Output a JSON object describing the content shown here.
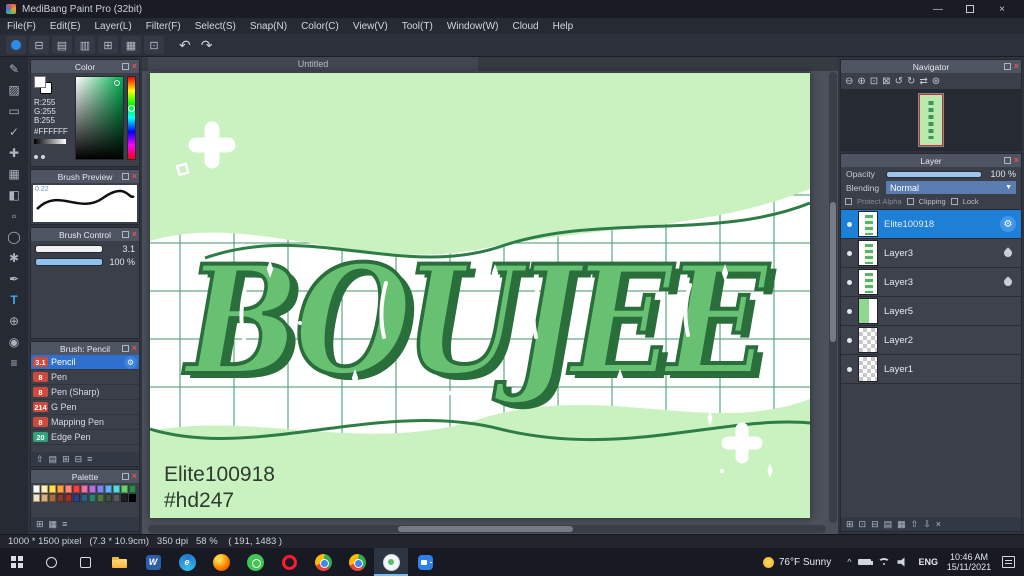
{
  "ui": {
    "close_glyph": "×",
    "caret_glyph": "▼"
  },
  "titlebar": {
    "title": "MediBang Paint Pro (32bit)",
    "minimize_glyph": "—",
    "close_glyph": "×"
  },
  "menubar": {
    "items": [
      {
        "name": "menu-file",
        "label": "File(F)"
      },
      {
        "name": "menu-edit",
        "label": "Edit(E)"
      },
      {
        "name": "menu-layer",
        "label": "Layer(L)"
      },
      {
        "name": "menu-filter",
        "label": "Filter(F)"
      },
      {
        "name": "menu-select",
        "label": "Select(S)"
      },
      {
        "name": "menu-snap",
        "label": "Snap(N)"
      },
      {
        "name": "menu-color",
        "label": "Color(C)"
      },
      {
        "name": "menu-view",
        "label": "View(V)"
      },
      {
        "name": "menu-tool",
        "label": "Tool(T)"
      },
      {
        "name": "menu-window",
        "label": "Window(W)"
      },
      {
        "name": "menu-cloud",
        "label": "Cloud"
      },
      {
        "name": "menu-help",
        "label": "Help"
      }
    ]
  },
  "toolbar": {
    "icons": [
      {
        "name": "save-icon",
        "glyph": "⊟"
      },
      {
        "name": "message-icon",
        "glyph": "▤"
      },
      {
        "name": "new-doc-icon",
        "glyph": "▥"
      },
      {
        "name": "open-doc-icon",
        "glyph": "⊞"
      },
      {
        "name": "grid-view-icon",
        "glyph": "▦"
      },
      {
        "name": "material-panel-icon",
        "glyph": "⊡"
      }
    ],
    "undo_glyph": "↶",
    "redo_glyph": "↷"
  },
  "tools": [
    {
      "name": "tool-brush",
      "glyph": "✎"
    },
    {
      "name": "tool-eraser",
      "glyph": "▨"
    },
    {
      "name": "tool-select-rect",
      "glyph": "▭"
    },
    {
      "name": "tool-snap",
      "glyph": "✓"
    },
    {
      "name": "tool-move",
      "glyph": "✚"
    },
    {
      "name": "tool-bucket",
      "glyph": "▦"
    },
    {
      "name": "tool-gradient",
      "glyph": "◧"
    },
    {
      "name": "tool-select",
      "glyph": "▫"
    },
    {
      "name": "tool-lasso",
      "glyph": "◯"
    },
    {
      "name": "tool-magic-wand",
      "glyph": "✱"
    },
    {
      "name": "tool-select-pen",
      "glyph": "✒"
    },
    {
      "name": "tool-text",
      "glyph": "T",
      "accent": true
    },
    {
      "name": "tool-eyedropper",
      "glyph": "⊕"
    },
    {
      "name": "tool-zoom",
      "glyph": "◉"
    },
    {
      "name": "tool-hand",
      "glyph": "≡"
    }
  ],
  "color_panel": {
    "title": "Color",
    "r": "R:255",
    "g": "G:255",
    "b": "B:255",
    "hex": "#FFFFFF"
  },
  "brush_preview": {
    "title": "Brush Preview",
    "value": "0.22"
  },
  "brush_control": {
    "title": "Brush Control",
    "size_value": "3.1",
    "opacity_value": "100 %"
  },
  "brush_panel": {
    "title": "Brush: Pencil",
    "gear_glyph": "⚙",
    "brushes": [
      {
        "size": "3.1",
        "name": "Pencil",
        "badge": "#d04a3c",
        "selected": true
      },
      {
        "size": "8",
        "name": "Pen",
        "badge": "#d04a3c"
      },
      {
        "size": "8",
        "name": "Pen (Sharp)",
        "badge": "#d04a3c"
      },
      {
        "size": "214",
        "name": "G Pen",
        "badge": "#d04a3c"
      },
      {
        "size": "8",
        "name": "Mapping Pen",
        "badge": "#d04a3c"
      },
      {
        "size": "20",
        "name": "Edge Pen",
        "badge": "#2fa37c"
      }
    ],
    "toolbar": [
      {
        "name": "brush-up-icon",
        "glyph": "⇧"
      },
      {
        "name": "brush-menu-icon",
        "glyph": "▤"
      },
      {
        "name": "add-brush-icon",
        "glyph": "⊞"
      },
      {
        "name": "remove-brush-icon",
        "glyph": "⊟"
      },
      {
        "name": "brush-settings-icon",
        "glyph": "≡"
      }
    ]
  },
  "palette_panel": {
    "title": "Palette",
    "colors": [
      "#ffffff",
      "#fff3b2",
      "#ffe14d",
      "#ffa343",
      "#ff8a80",
      "#f4433c",
      "#f06fae",
      "#b96fd8",
      "#7e86f2",
      "#5fb2f5",
      "#59dcd8",
      "#6fd06f",
      "#2e8b4a",
      "#f2e3c2",
      "#d8b07e",
      "#a3713f",
      "#7e402e",
      "#a33030",
      "#2e4080",
      "#2e6080",
      "#2e8070",
      "#4f7840",
      "#3f503f",
      "#59595f",
      "#1f1f23",
      "#000000"
    ],
    "toolbar": [
      {
        "name": "add-color-icon",
        "glyph": "⊞"
      },
      {
        "name": "delete-color-icon",
        "glyph": "▦"
      },
      {
        "name": "palette-menu-icon",
        "glyph": "≡"
      }
    ]
  },
  "canvas": {
    "tab": "Untitled",
    "artwork_text": "BOUJEE",
    "signature_line1": "Elite100918",
    "signature_line2": "#hd247",
    "bg_color": "#c9f2c0",
    "letter_color": "#68c173"
  },
  "navigator": {
    "title": "Navigator",
    "toolbar": [
      {
        "name": "zoom-out-icon",
        "glyph": "⊖"
      },
      {
        "name": "zoom-in-icon",
        "glyph": "⊕"
      },
      {
        "name": "zoom-fit-icon",
        "glyph": "⊡"
      },
      {
        "name": "zoom-100-icon",
        "glyph": "⊠"
      },
      {
        "name": "rotate-left-icon",
        "glyph": "↺"
      },
      {
        "name": "rotate-right-icon",
        "glyph": "↻"
      },
      {
        "name": "flip-view-icon",
        "glyph": "⇄"
      },
      {
        "name": "reset-view-icon",
        "glyph": "⊛"
      }
    ]
  },
  "layer_panel": {
    "title": "Layer",
    "opacity_label": "Opacity",
    "opacity_value": "100 %",
    "blending_label": "Blending",
    "blending_value": "Normal",
    "protect_alpha_label": "Protect Alpha",
    "clipping_label": "Clipping",
    "lock_label": "Lock",
    "gear_glyph": "⚙",
    "layers": [
      {
        "name": "Elite100918",
        "thumb": "art",
        "selected": true,
        "gear": true
      },
      {
        "name": "Layer3",
        "thumb": "art",
        "drop": true
      },
      {
        "name": "Layer3",
        "thumb": "art",
        "drop": true
      },
      {
        "name": "Layer5",
        "thumb": "halfgreen"
      },
      {
        "name": "Layer2",
        "thumb": "checker"
      },
      {
        "name": "Layer1",
        "thumb": "checker"
      }
    ],
    "toolbar": [
      {
        "name": "add-layer-icon",
        "glyph": "⊞"
      },
      {
        "name": "duplicate-layer-icon",
        "glyph": "⊡"
      },
      {
        "name": "merge-layer-icon",
        "glyph": "⊟"
      },
      {
        "name": "layer-folder-icon",
        "glyph": "▤"
      },
      {
        "name": "convert-layer-icon",
        "glyph": "▦"
      },
      {
        "name": "layer-up-icon",
        "glyph": "⇧"
      },
      {
        "name": "layer-down-icon",
        "glyph": "⇩"
      },
      {
        "name": "delete-layer-icon",
        "glyph": "×"
      }
    ]
  },
  "statusbar": {
    "text": "1000 * 1500 pixel   (7.3 * 10.9cm)   350 dpi   58 %    ( 191, 1483 )"
  },
  "taskbar": {
    "apps": [
      {
        "name": "file-explorer-icon",
        "kind": "folder"
      },
      {
        "name": "word-icon",
        "kind": "word",
        "letter": "W"
      },
      {
        "name": "edge-icon",
        "kind": "edge",
        "letter": "e"
      },
      {
        "name": "firefox-icon",
        "kind": "firefox"
      },
      {
        "name": "whatsapp-icon",
        "kind": "whatsapp"
      },
      {
        "name": "opera-icon",
        "kind": "opera"
      },
      {
        "name": "chrome-icon",
        "kind": "chrome"
      },
      {
        "name": "chrome-profile2-icon",
        "kind": "chrome"
      },
      {
        "name": "medibang-taskbar-icon",
        "kind": "medibang",
        "active": true
      },
      {
        "name": "camera-app-icon",
        "kind": "camera"
      }
    ],
    "weather": "76°F Sunny",
    "lang": "ENG",
    "time": "10:46 AM",
    "date": "15/11/2021"
  }
}
